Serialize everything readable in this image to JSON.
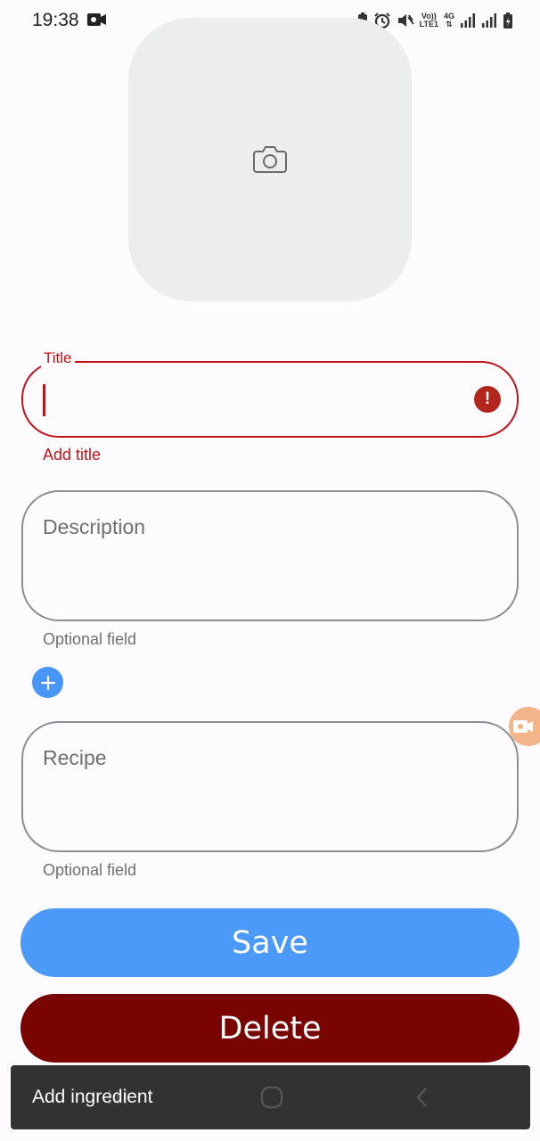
{
  "status_bar": {
    "time": "19:38",
    "network_label_top": "Vo))",
    "network_label_bottom": "LTE1",
    "network_type": "4G",
    "icons": [
      "video-record-icon",
      "battery-saver-icon",
      "alarm-icon",
      "mute-icon",
      "signal-icon",
      "signal-icon",
      "battery-icon"
    ]
  },
  "photo": {
    "icon": "camera-icon"
  },
  "title_field": {
    "label": "Title",
    "value": "",
    "error": "Add title",
    "error_color": "#c0141a"
  },
  "description_field": {
    "placeholder": "Description",
    "helper": "Optional field"
  },
  "add_ingredient_button": {
    "icon": "plus-icon",
    "color": "#4796f7"
  },
  "recipe_field": {
    "placeholder": "Recipe",
    "helper": "Optional field"
  },
  "buttons": {
    "save": "Save",
    "delete": "Delete",
    "save_color": "#4b99f8",
    "delete_color": "#790503"
  },
  "snackbar": {
    "text": "Add ingredient"
  },
  "nav_bar": {
    "icons": [
      "recent-apps-icon",
      "home-icon",
      "back-icon"
    ]
  }
}
